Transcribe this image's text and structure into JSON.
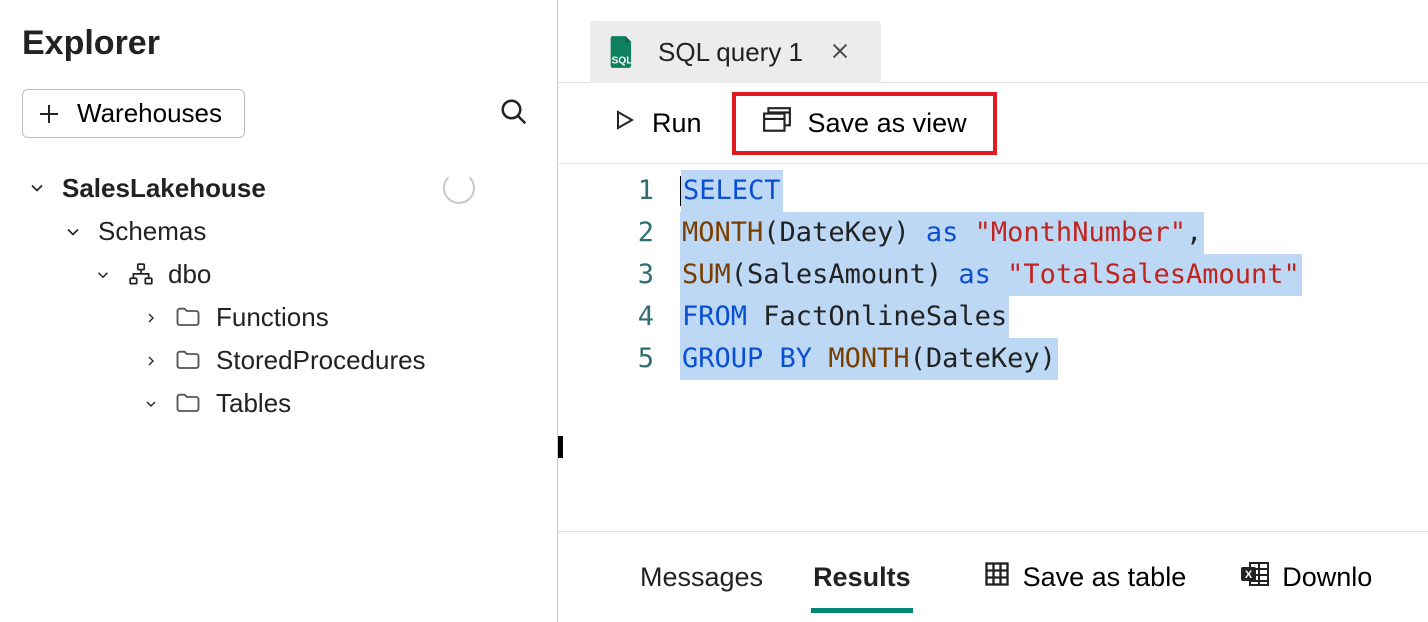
{
  "explorer": {
    "title": "Explorer",
    "warehouses_button": "Warehouses",
    "tree": {
      "root": "SalesLakehouse",
      "schemas_label": "Schemas",
      "schema_name": "dbo",
      "folders": {
        "functions": "Functions",
        "stored_procedures": "StoredProcedures",
        "tables": "Tables"
      }
    }
  },
  "tab": {
    "label": "SQL query 1"
  },
  "toolbar": {
    "run": "Run",
    "save_as_view": "Save as view"
  },
  "code": {
    "line_numbers": [
      "1",
      "2",
      "3",
      "4",
      "5"
    ],
    "l1": {
      "select": "SELECT"
    },
    "l2": {
      "month": "MONTH",
      "open": "(",
      "arg": "DateKey",
      "close": ")",
      "as": "as",
      "str": "\"MonthNumber\"",
      "comma": ","
    },
    "l3": {
      "sum": "SUM",
      "open": "(",
      "arg": "SalesAmount",
      "close": ")",
      "as": "as",
      "str": "\"TotalSalesAmount\""
    },
    "l4": {
      "from": "FROM",
      "tbl": "FactOnlineSales"
    },
    "l5": {
      "group": "GROUP",
      "by": "BY",
      "month": "MONTH",
      "open": "(",
      "arg": "DateKey",
      "close": ")"
    }
  },
  "results": {
    "messages": "Messages",
    "results": "Results",
    "save_as_table": "Save as table",
    "download": "Downlo"
  }
}
